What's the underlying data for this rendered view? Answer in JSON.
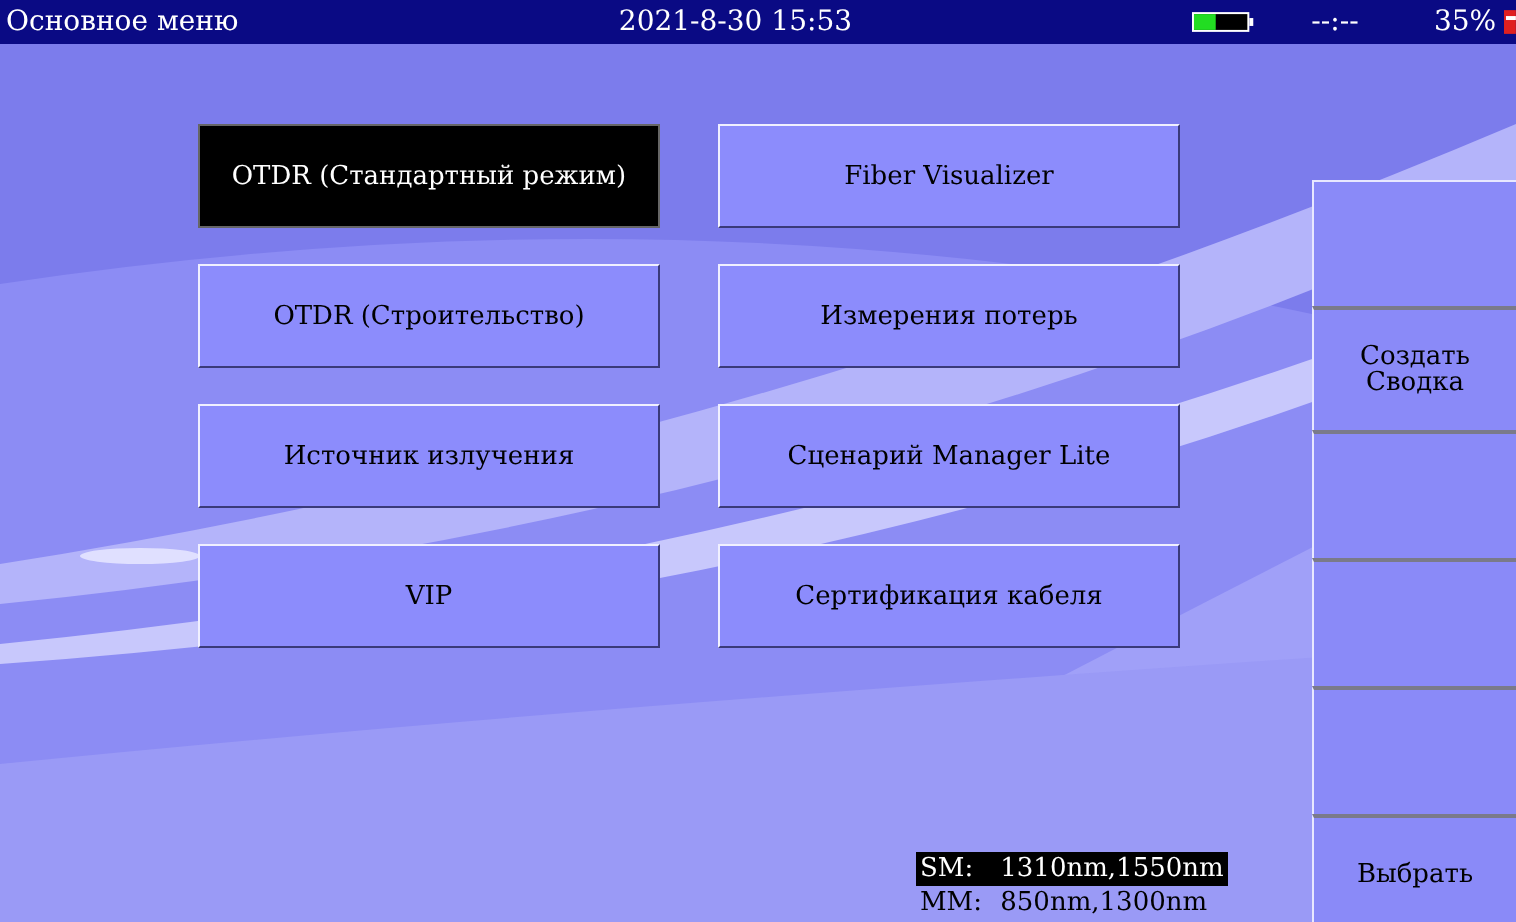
{
  "title_bar": {
    "title": "Основное меню",
    "datetime": "2021-8-30 15:53",
    "clock": "--:--",
    "percent": "35%"
  },
  "menu": [
    {
      "label": "OTDR (Стандартный режим)",
      "selected": true
    },
    {
      "label": "Fiber Visualizer",
      "selected": false
    },
    {
      "label": "OTDR (Строительство)",
      "selected": false
    },
    {
      "label": "Измерения потерь",
      "selected": false
    },
    {
      "label": "Источник излучения",
      "selected": false
    },
    {
      "label": "Сценарий Manager Lite",
      "selected": false
    },
    {
      "label": "VIP",
      "selected": false
    },
    {
      "label": "Сертификация кабеля",
      "selected": false
    }
  ],
  "side_buttons": [
    {
      "kind": "blank"
    },
    {
      "kind": "label",
      "lines": [
        "Создать",
        "Сводка"
      ]
    },
    {
      "kind": "blank"
    },
    {
      "kind": "blank"
    },
    {
      "kind": "blank"
    },
    {
      "kind": "label",
      "lines": [
        "Выбрать"
      ]
    }
  ],
  "fiber_modes": [
    {
      "mode": "SM:",
      "wavelengths": "1310nm,1550nm",
      "selected": true
    },
    {
      "mode": "MM:",
      "wavelengths": "850nm,1300nm",
      "selected": false
    }
  ]
}
